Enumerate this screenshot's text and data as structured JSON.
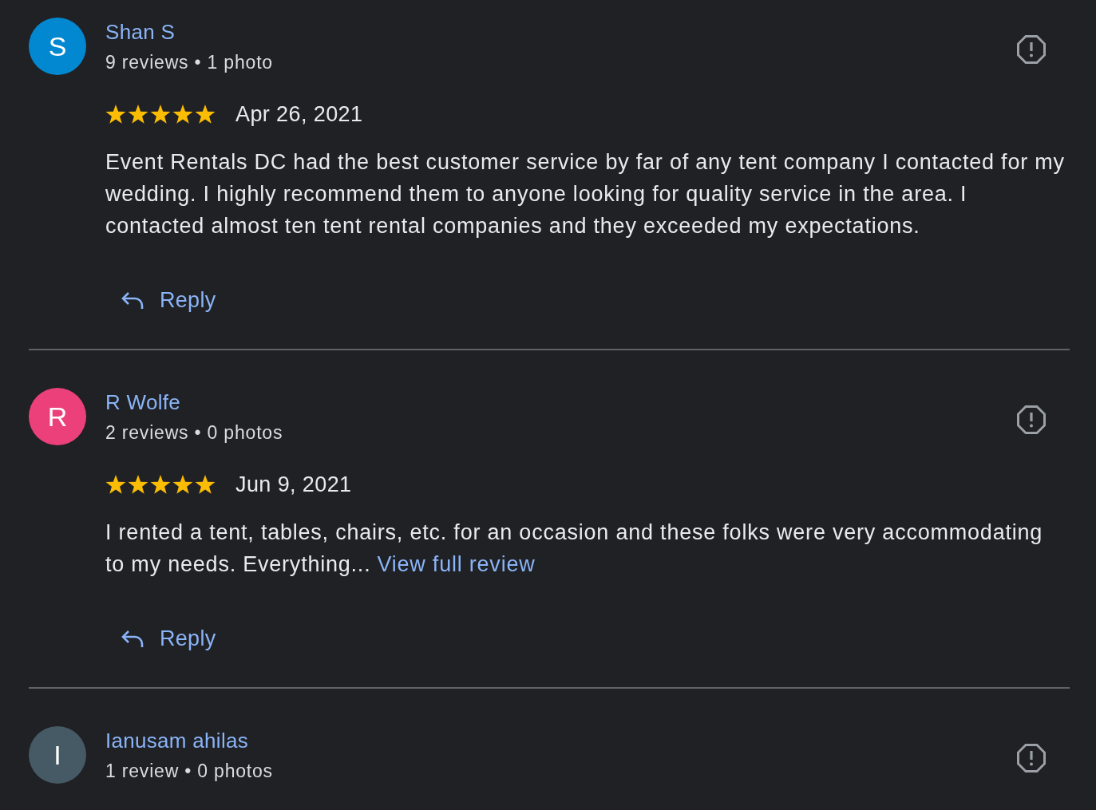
{
  "reviews": [
    {
      "author": "Shan S",
      "avatar": {
        "letter": "S",
        "color": "#0288d1"
      },
      "meta": "9 reviews • 1 photo",
      "stars": 5,
      "date": "Apr 26, 2021",
      "text": "Event Rentals DC had the best customer service by far of any tent company I contacted for my wedding. I highly recommend them to anyone looking for quality service in the area. I contacted almost ten tent rental companies and they exceeded my expectations.",
      "reply_label": "Reply"
    },
    {
      "author": "R Wolfe",
      "avatar": {
        "letter": "R",
        "color": "#ec407a"
      },
      "meta": "2 reviews • 0 photos",
      "stars": 5,
      "date": "Jun 9, 2021",
      "text": "I rented a tent, tables, chairs, etc. for an occasion and these folks were very accommodating to my needs. Everything...",
      "more_link": "View full review",
      "reply_label": "Reply"
    },
    {
      "author": "Ianusam ahilas",
      "avatar": {
        "letter": "I",
        "color": "#455a64"
      },
      "meta": "1 review • 0 photos"
    }
  ]
}
